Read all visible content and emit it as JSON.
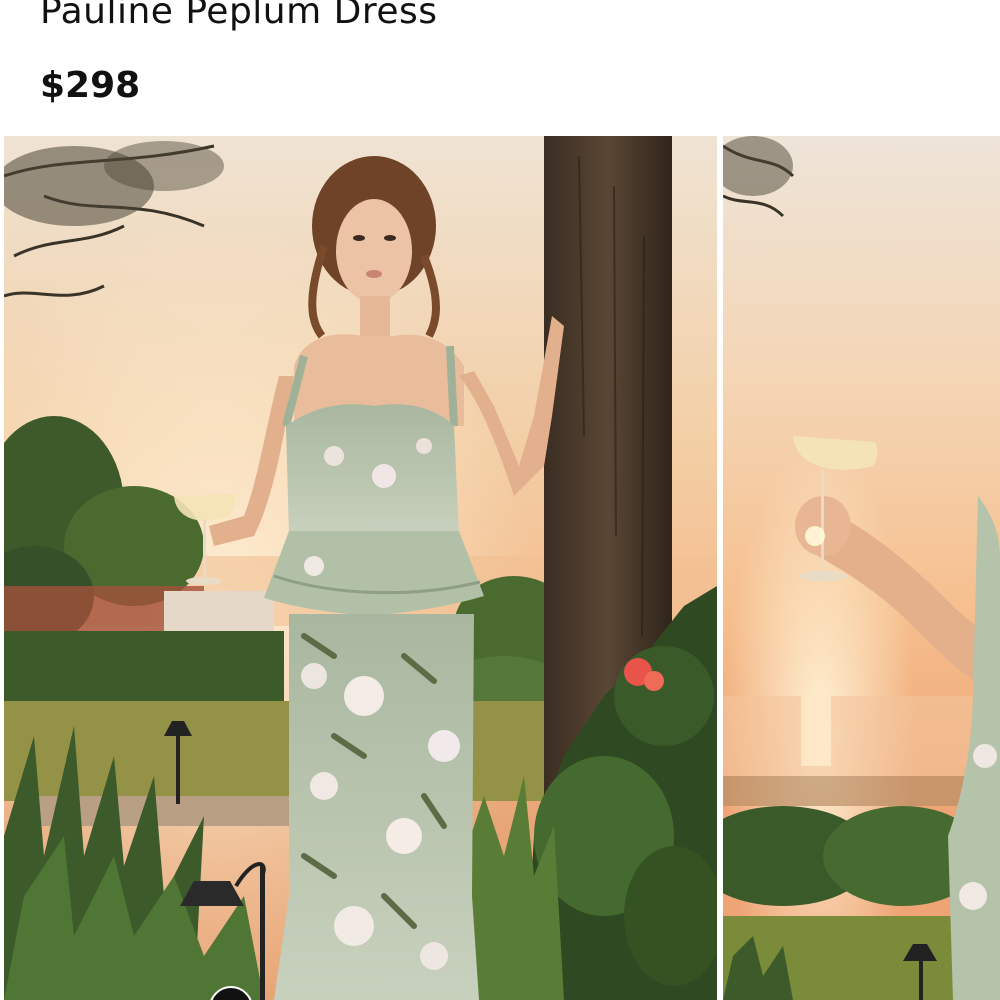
{
  "product": {
    "title": "Pauline Peplum Dress",
    "price": "$298"
  },
  "gallery": {
    "images": [
      {
        "name": "model-in-floral-peplum-dress-at-sunset"
      },
      {
        "name": "hand-holding-coupe-glass-at-sunset"
      }
    ]
  },
  "colors": {
    "sky_warm": "#f3c89a",
    "sun_glow": "#fbe7c4",
    "dress_sage": "#b7c6ae",
    "foliage": "#3f5a2c",
    "post_wood": "#4a3a2c",
    "text": "#111111"
  }
}
